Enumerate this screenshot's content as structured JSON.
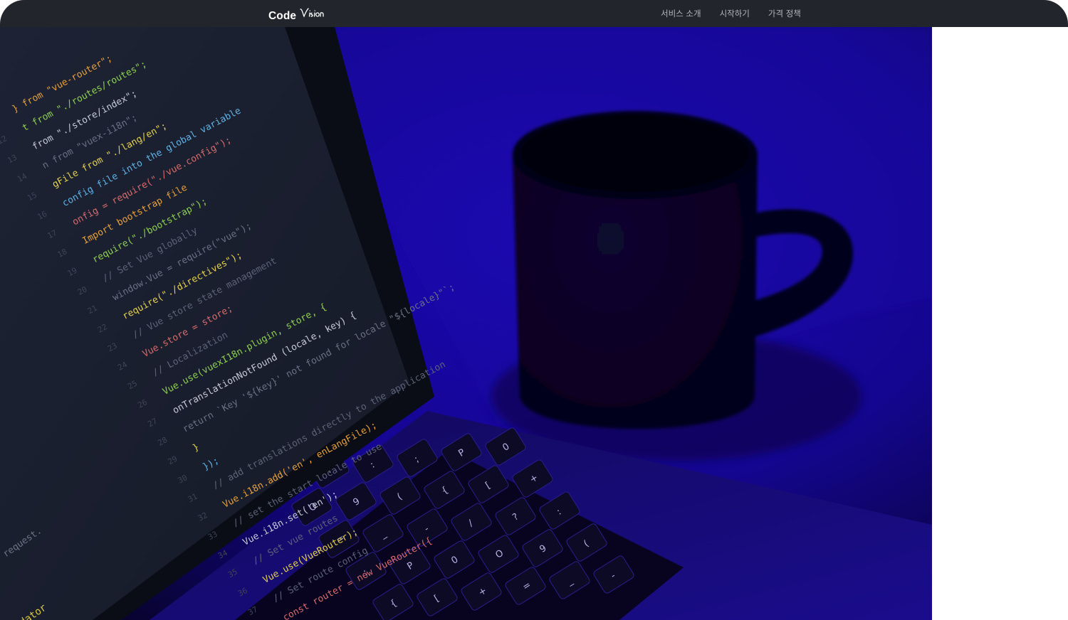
{
  "header": {
    "brand": {
      "main": "Code",
      "script": "Vision"
    },
    "nav": [
      {
        "label": "서비스 소개"
      },
      {
        "label": "시작하기"
      },
      {
        "label": "가격 정책"
      }
    ]
  },
  "hero": {
    "image": "laptop-code-and-coffee-mug-photo",
    "accent": "#1a00b8",
    "code_lines": [
      "} from \"vue-router\";",
      "t from \"./routes/routes\";",
      "from \"./store/index\";",
      "n from \"vuex-i18n\";",
      "gFile from \"./lang/en\";",
      "config file into the global variable",
      "onfig = require(\"./vue.config\");",
      "Import bootstrap file",
      "require(\"./bootstrap\");",
      "// Set Vue globally",
      "window.Vue = require(\"vue\");",
      "require(\"./directives\");",
      "// Vue store state management",
      "Vue.store = store;",
      "// Localization",
      "Vue.use(vuexI18n.plugin, store, {",
      "onTranslationNotFound (locale, key) {",
      "return `Key '${key}' not found for locale \"${locale}\"`;",
      "}",
      "});",
      "// add translations directly to the application",
      "Vue.i18n.add('en', enLangFile);",
      "// set the start locale to use",
      "Vue.i18n.set('en');",
      "// Set vue routes",
      "Vue.use(VueRouter);",
      "// Set route config",
      "const router = new VueRouter({"
    ],
    "line_numbers": [
      "12",
      "13",
      "14",
      "15",
      "16",
      "17",
      "18",
      "19",
      "20",
      "21",
      "22",
      "23",
      "24",
      "25",
      "26",
      "27",
      "28",
      "29",
      "30",
      "31",
      "32",
      "33",
      "34",
      "35",
      "36",
      "37",
      "38"
    ],
    "side_text": [
      "request.",
      "Validator"
    ],
    "keys": [
      "/",
      "?",
      ":",
      ";",
      "P",
      "0",
      "O",
      "9",
      "(",
      "{",
      "[",
      "+",
      "=",
      "_",
      "-"
    ]
  }
}
